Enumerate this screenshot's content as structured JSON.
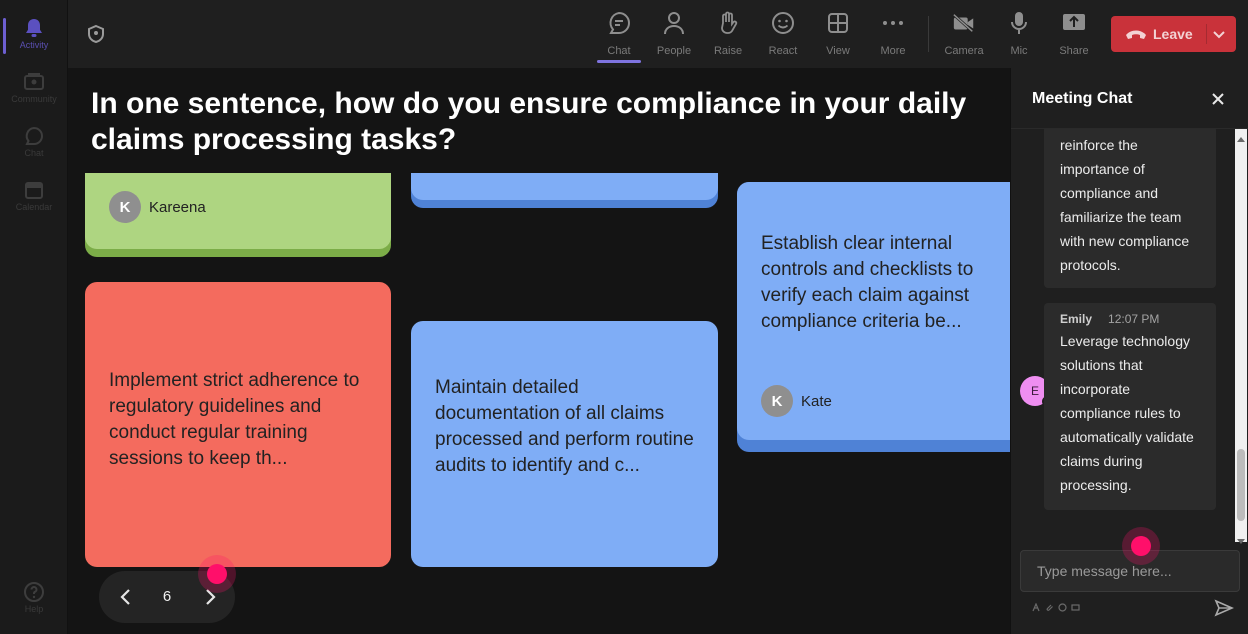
{
  "rail": {
    "items": [
      {
        "label": "Activity",
        "icon": "bell-icon",
        "active": true
      },
      {
        "label": "Community",
        "icon": "community-icon"
      },
      {
        "label": "Chat",
        "icon": "chat-icon"
      },
      {
        "label": "Calendar",
        "icon": "calendar-icon"
      }
    ],
    "help": {
      "label": "Help",
      "icon": "help-icon"
    }
  },
  "toolbar": {
    "chat": "Chat",
    "people": "People",
    "raise": "Raise",
    "react": "React",
    "view": "View",
    "more": "More",
    "camera": "Camera",
    "mic": "Mic",
    "share": "Share",
    "leave": "Leave"
  },
  "stage": {
    "question": "In one sentence, how do you ensure compliance in your daily claims processing tasks?",
    "cards": [
      {
        "color": "#aed581",
        "author": "Kareena",
        "initial": "K"
      },
      {
        "color": "#7fadf6"
      },
      {
        "color": "#7fadf6",
        "text": "Establish clear internal controls and checklists to verify each claim against compliance criteria be...",
        "author": "Kate",
        "initial": "K"
      },
      {
        "color": "#f46b5e",
        "text": "Implement strict adherence to regulatory guidelines and conduct regular training sessions to keep th..."
      },
      {
        "color": "#7fadf6",
        "text": "Maintain detailed documentation of all claims processed and perform routine audits to identify and c..."
      }
    ],
    "page": "6"
  },
  "chat": {
    "title": "Meeting Chat",
    "messages": [
      {
        "text": "reinforce the importance of compliance and familiarize the team with new compliance protocols."
      },
      {
        "author": "Emily",
        "initial": "E",
        "time": "12:07 PM",
        "text": "Leverage technology solutions that incorporate compliance rules to automatically validate claims during processing."
      }
    ],
    "input_placeholder": "Type message here..."
  },
  "colors": {
    "leave": "#c9323a",
    "accent": "#7f74e0",
    "green_card": "#aed581",
    "blue_card": "#7fadf6",
    "red_card": "#f46b5e"
  }
}
